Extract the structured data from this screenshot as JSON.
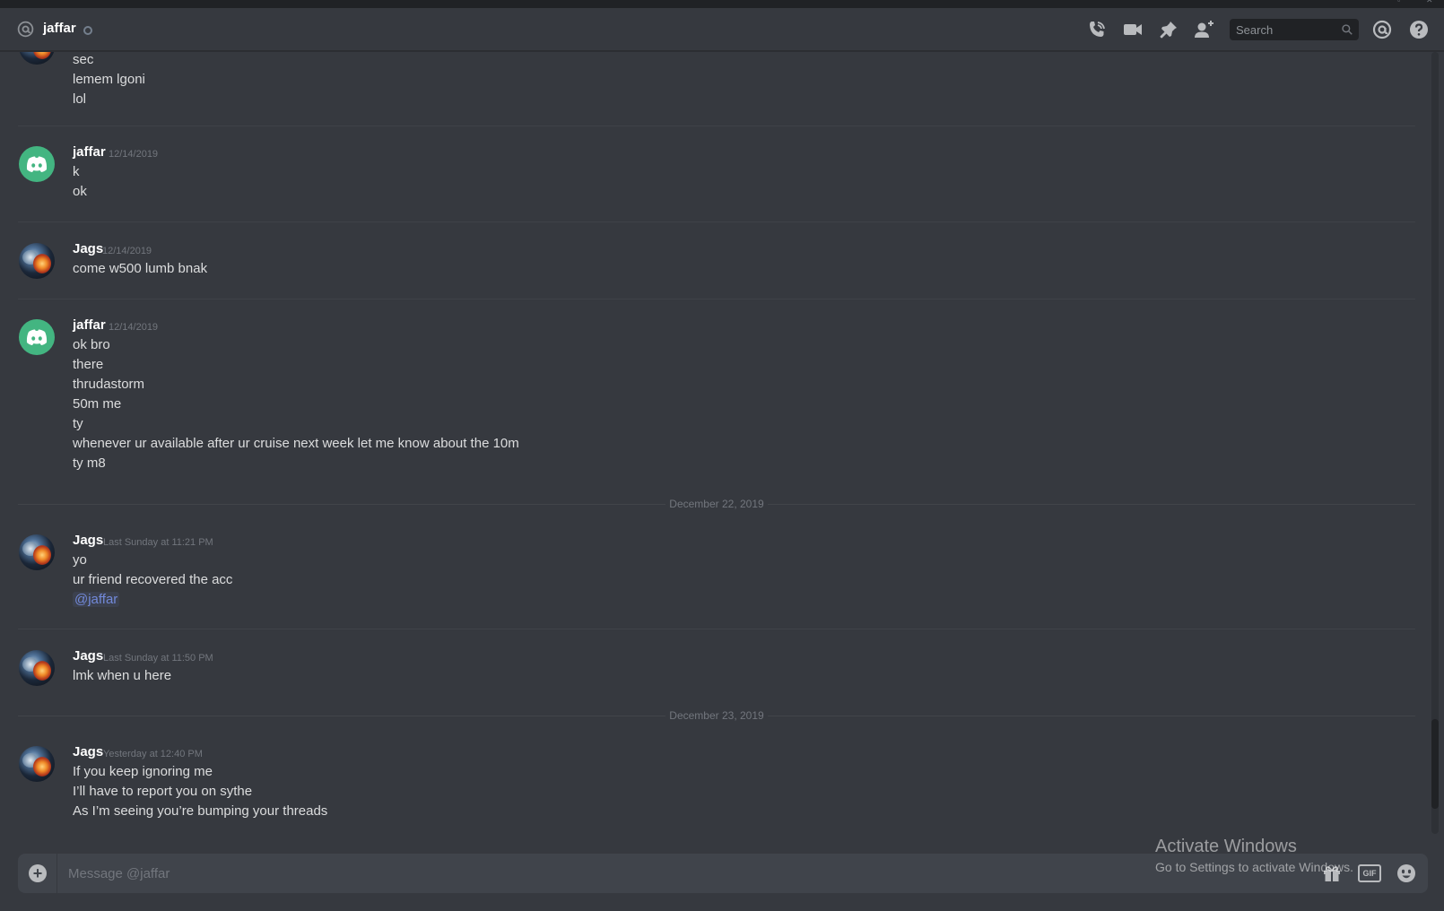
{
  "header": {
    "channel_name": "jaffar",
    "search_placeholder": "Search"
  },
  "icons": {
    "at": "at-sign-icon",
    "call": "phone-call-icon",
    "video": "video-camera-icon",
    "pin": "pin-icon",
    "add_friend": "add-friend-icon",
    "search": "search-icon",
    "mentions": "mentions-icon",
    "help": "help-icon",
    "attach": "plus-circle-icon",
    "gift": "gift-icon",
    "emoji": "emoji-icon"
  },
  "messages": {
    "group0": {
      "lines": [
        "sec",
        "lemem lgoni",
        "lol"
      ]
    },
    "group1": {
      "author": "jaffar",
      "timestamp": "12/14/2019",
      "lines": [
        "k",
        "ok"
      ]
    },
    "group2": {
      "author": "Jags",
      "timestamp": "12/14/2019",
      "lines": [
        "come w500 lumb bnak"
      ]
    },
    "group3": {
      "author": "jaffar",
      "timestamp": "12/14/2019",
      "lines": [
        "ok bro",
        "there",
        "thrudastorm",
        "50m me",
        "ty",
        "whenever ur available after ur cruise next week let me know about the 10m",
        "ty m8"
      ]
    },
    "sep1": "December 22, 2019",
    "group4": {
      "author": "Jags",
      "timestamp": "Last Sunday at 11:21 PM",
      "lines": [
        "yo",
        "ur friend recovered the acc"
      ],
      "mention": "@jaffar"
    },
    "group5": {
      "author": "Jags",
      "timestamp": "Last Sunday at 11:50 PM",
      "lines": [
        "lmk when u here"
      ]
    },
    "sep2": "December 23, 2019",
    "group6": {
      "author": "Jags",
      "timestamp": "Yesterday at 12:40 PM",
      "lines": [
        "If you keep ignoring me",
        "I’ll have to report you on sythe",
        "As I’m seeing you’re bumping your threads"
      ]
    }
  },
  "composer": {
    "placeholder": "Message @jaffar",
    "gif_label": "GIF"
  },
  "watermark": {
    "title": "Activate Windows",
    "subtitle": "Go to Settings to activate Windows."
  },
  "colors": {
    "background": "#36393f",
    "online_avatar": "#43b581",
    "mention": "#7289da"
  }
}
